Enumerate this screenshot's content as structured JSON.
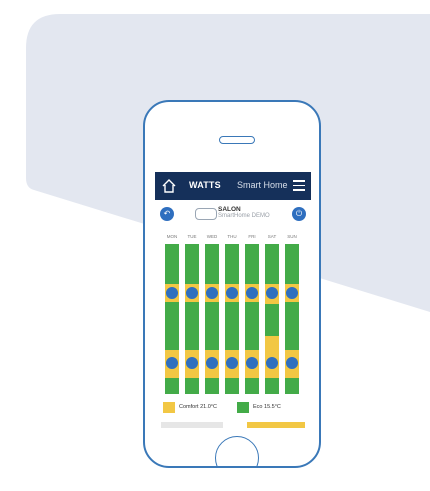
{
  "app": {
    "brand": "WATTS",
    "brand_sub": "Smart Home"
  },
  "room": {
    "name": "SALON",
    "subtitle": "SmartHome DEMO"
  },
  "days": [
    "MON",
    "TUE",
    "WED",
    "THU",
    "FRI",
    "SAT",
    "SUN"
  ],
  "legend": {
    "comfort": "Comfort 21.0°C",
    "eco": "Eco 15.5°C"
  },
  "colors": {
    "comfort": "#f2c744",
    "eco": "#43ab48",
    "header": "#15305a",
    "accent": "#2f6fbf"
  },
  "icons": {
    "home": "home-icon",
    "menu": "hamburger-menu-icon",
    "prev": "arrow-left-icon",
    "next": "power-icon"
  }
}
